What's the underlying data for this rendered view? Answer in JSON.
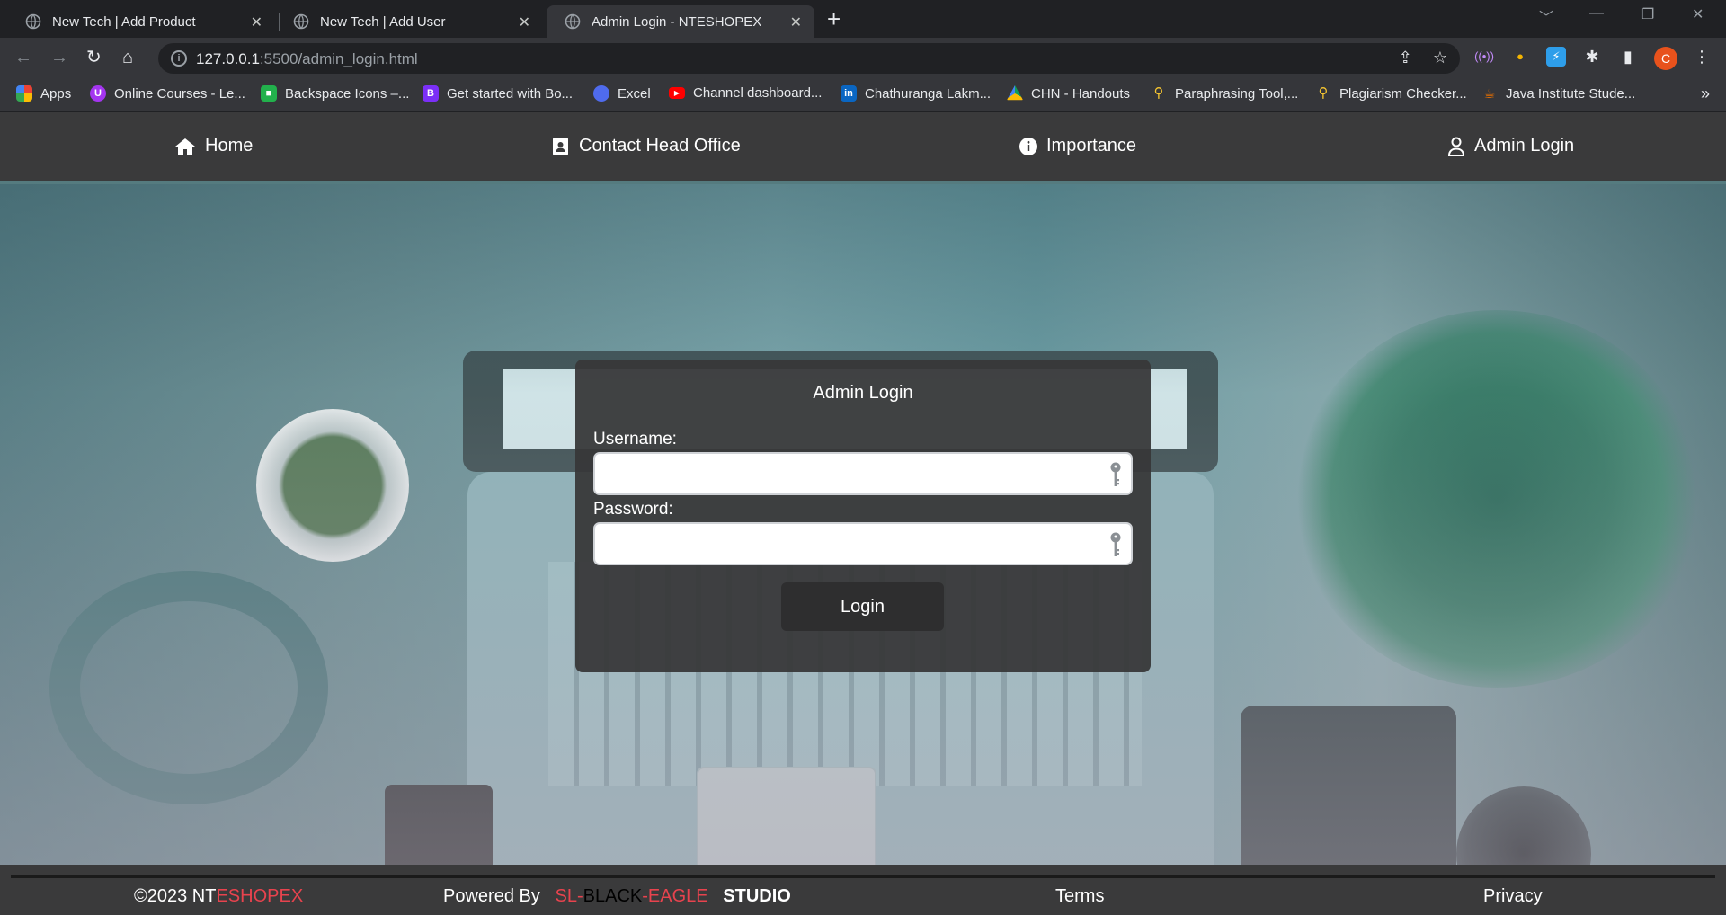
{
  "browser": {
    "tabs": [
      {
        "title": "New Tech | Add Product",
        "active": false
      },
      {
        "title": "New Tech | Add User",
        "active": false
      },
      {
        "title": "Admin Login - NTESHOPEX",
        "active": true
      }
    ],
    "url_host": "127.0.0.1",
    "url_path": ":5500/admin_login.html",
    "profile_initial": "C",
    "bookmarks": [
      {
        "label": "Apps",
        "icon": "apps-grid-icon"
      },
      {
        "label": "Online Courses - Le...",
        "icon": "udemy-icon"
      },
      {
        "label": "Backspace Icons –...",
        "icon": "backspace-icon"
      },
      {
        "label": "Get started with Bo...",
        "icon": "bootstrap-icon"
      },
      {
        "label": "Excel",
        "icon": "excel-icon"
      },
      {
        "label": "Channel dashboard...",
        "icon": "youtube-icon"
      },
      {
        "label": "Chathuranga Lakm...",
        "icon": "linkedin-icon"
      },
      {
        "label": "CHN - Handouts",
        "icon": "google-drive-icon"
      },
      {
        "label": "Paraphrasing Tool,...",
        "icon": "search-tool-icon"
      },
      {
        "label": "Plagiarism Checker...",
        "icon": "search-tool-icon"
      },
      {
        "label": "Java Institute Stude...",
        "icon": "java-icon"
      }
    ]
  },
  "site_nav": {
    "home": "Home",
    "contact": "Contact Head Office",
    "importance": "Importance",
    "admin_login": "Admin Login"
  },
  "login_form": {
    "title": "Admin Login",
    "username_label": "Username:",
    "username_value": "",
    "password_label": "Password:",
    "password_value": "",
    "submit_label": "Login"
  },
  "footer": {
    "copyright_prefix": "©2023 NT",
    "copyright_brand": "ESHOPEX",
    "powered_prefix": "Powered By",
    "powered_sl": "SL-",
    "powered_black": "BLACK",
    "powered_eagle": "-EAGLE",
    "powered_studio": "STUDIO",
    "terms": "Terms",
    "privacy": "Privacy"
  },
  "colors": {
    "accent_red": "#e8434e",
    "nav_bg": "#3a3a3b",
    "card_bg": "#373738",
    "profile_orange": "#e8521c"
  }
}
